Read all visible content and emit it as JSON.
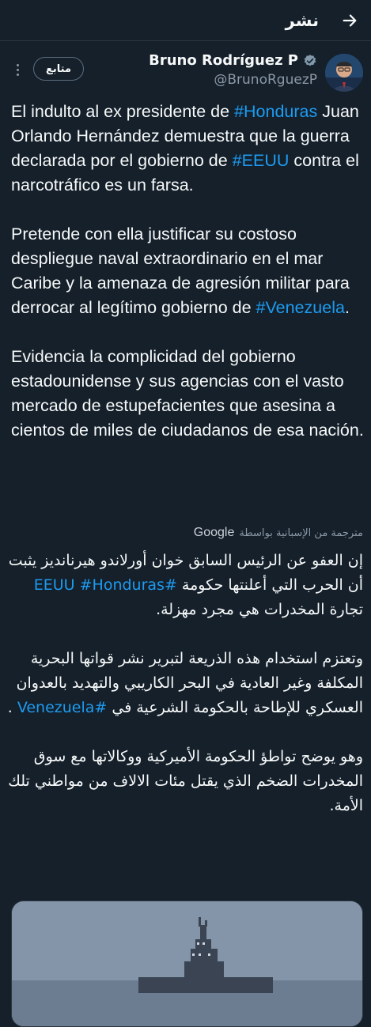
{
  "topbar": {
    "title": "نشر",
    "back_icon": "arrow-right-icon"
  },
  "author": {
    "name": "Bruno Rodríguez P",
    "handle": "@BrunoRguezP",
    "verified_icon": "verified-badge-icon",
    "follow_label": "متابع"
  },
  "tweet": {
    "paragraphs": [
      [
        {
          "t": "El indulto al ex presidente de "
        },
        {
          "t": "#Honduras",
          "tag": true
        },
        {
          "t": " Juan Orlando Hernández demuestra que la guerra declarada por el gobierno de "
        },
        {
          "t": "#EEUU",
          "tag": true
        },
        {
          "t": " contra el narcotráfico es un farsa."
        }
      ],
      [
        {
          "t": "Pretende con ella justificar su costoso despliegue naval extraordinario en el mar Caribe y la amenaza de agresión militar para derrocar al legítimo gobierno de "
        },
        {
          "t": "#Venezuela",
          "tag": true
        },
        {
          "t": "."
        }
      ],
      [
        {
          "t": "Evidencia la complicidad del gobierno estadounidense y sus agencias con el vasto mercado de estupefacientes que asesina a cientos de miles de ciudadanos de esa nación."
        }
      ]
    ]
  },
  "translation_meta": {
    "label": "مترجمة من الإسبانية بواسطة",
    "provider": "Google"
  },
  "translation": {
    "paragraphs": [
      [
        {
          "t": "إن العفو عن الرئيس السابق خوان أورلاندو هيرنانديز يثبت أن الحرب التي أعلنتها حكومة "
        },
        {
          "t": "#EEUU",
          "tag": true
        },
        {
          "t": " "
        },
        {
          "t": "#Honduras",
          "tag": true
        },
        {
          "t": " تجارة المخدرات هي مجرد مهزلة."
        }
      ],
      [
        {
          "t": "وتعتزم استخدام هذه الذريعة لتبرير نشر قواتها البحرية المكلفة وغير العادية في البحر الكاريبي والتهديد بالعدوان العسكري للإطاحة بالحكومة الشرعية في "
        },
        {
          "t": "#Venezuela",
          "tag": true
        },
        {
          "t": " ."
        }
      ],
      [
        {
          "t": "وهو يوضح تواطؤ الحكومة الأميركية ووكالاتها مع سوق المخدرات الضخم الذي يقتل مئات الالاف من مواطني تلك الأمة."
        }
      ]
    ]
  },
  "colors": {
    "background": "#15202b",
    "hashtag": "#1d9bf0",
    "muted": "#8b98a5"
  }
}
